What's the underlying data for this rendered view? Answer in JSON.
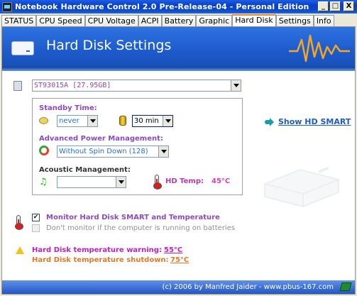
{
  "window": {
    "title": "Notebook Hardware Control 2.0 Pre-Release-04  -  Personal Edition",
    "controls": {
      "minimize": "_",
      "maximize": "□",
      "close": "X"
    }
  },
  "tabs": [
    {
      "label": "STATUS"
    },
    {
      "label": "CPU Speed"
    },
    {
      "label": "CPU Voltage"
    },
    {
      "label": "ACPI"
    },
    {
      "label": "Battery"
    },
    {
      "label": "Graphic"
    },
    {
      "label": "Hard Disk",
      "active": true
    },
    {
      "label": "Settings"
    },
    {
      "label": "Info"
    }
  ],
  "header": {
    "title": "Hard Disk Settings"
  },
  "drive_select": {
    "value": "ST93015A  [27.95GB]"
  },
  "standby": {
    "label": "Standby Time:",
    "left_value": "never",
    "right_value": "30 min"
  },
  "apm": {
    "label": "Advanced Power Management:",
    "value": "Without Spin Down (128)"
  },
  "acoustic": {
    "label": "Acoustic Management:",
    "value": ""
  },
  "hd_temp": {
    "label": "HD Temp:",
    "value": "45°C"
  },
  "show_smart": {
    "label": "Show HD SMART"
  },
  "monitor": {
    "smart_label": "Monitor Hard Disk SMART and Temperature",
    "smart_checked": true,
    "battery_label": "Don't monitor if the computer is running on batteries",
    "battery_checked": false
  },
  "warnings": {
    "warning_label": "Hard Disk temperature warning:",
    "warning_value": "55°C",
    "shutdown_label": "Hard Disk temperature shutdown:",
    "shutdown_value": "75°C"
  },
  "footer": {
    "text": "(c) 2006 by Manfred Jaider - www.pbus-167.com"
  },
  "colors": {
    "header_blue": "#1d5bcc",
    "label_purple": "#8c4ac0",
    "warning_magenta": "#c020c0",
    "shutdown_orange": "#e07a2a"
  }
}
